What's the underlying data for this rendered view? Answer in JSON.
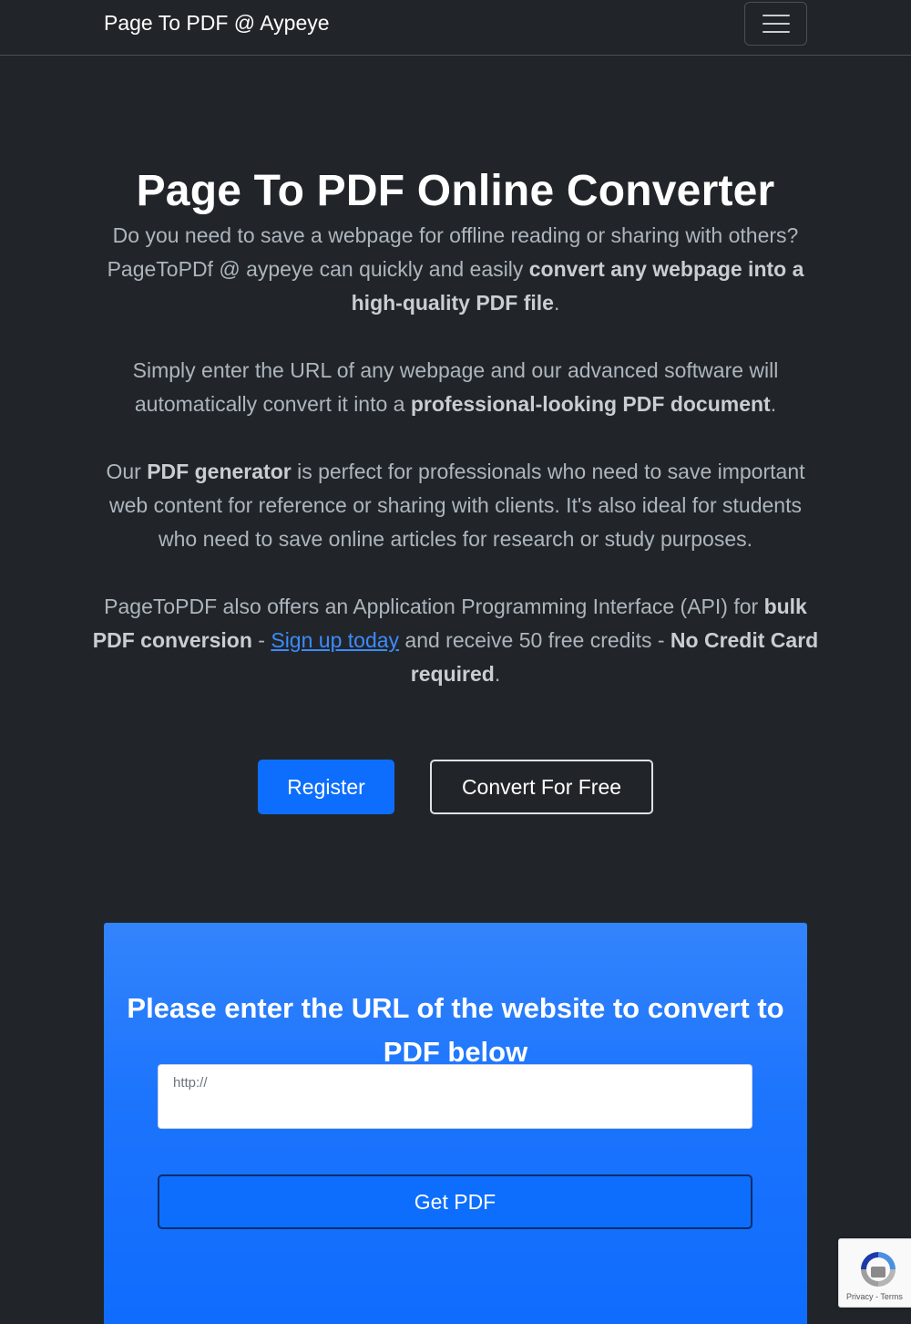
{
  "navbar": {
    "brand": "Page To PDF @ Aypeye",
    "toggler_icon": "hamburger-menu-icon"
  },
  "hero": {
    "title": "Page To PDF Online Converter",
    "p1": {
      "text1": "Do you need to save a webpage for offline reading or sharing with others? PageToPDf @ aypeye can quickly and easily ",
      "bold1": "convert any webpage into a high-quality PDF file",
      "text2": "."
    },
    "p2": {
      "text1": "Simply enter the URL of any webpage and our advanced software will automatically convert it into a ",
      "bold1": "professional-looking PDF document",
      "text2": "."
    },
    "p3": {
      "text1": "Our ",
      "bold1": "PDF generator",
      "text2": " is perfect for professionals who need to save important web content for reference or sharing with clients. It's also ideal for students who need to save online articles for research or study purposes."
    },
    "p4": {
      "text1": "PageToPDF also offers an Application Programming Interface (API) for ",
      "bold1": "bulk PDF conversion",
      "text2": " - ",
      "link": "Sign up today",
      "text3": " and receive 50 free credits - ",
      "bold2": "No Credit Card required",
      "text4": "."
    }
  },
  "buttons": {
    "register": "Register",
    "convert": "Convert For Free"
  },
  "converter": {
    "heading": "Please enter the URL of the website to convert to PDF below",
    "url_placeholder": "http://",
    "url_value": "",
    "submit": "Get PDF"
  },
  "recaptcha": {
    "icon": "recaptcha-icon",
    "terms": "Privacy - Terms"
  },
  "colors": {
    "background": "#212529",
    "primary": "#0d6efd",
    "link": "#3d8bfd"
  }
}
